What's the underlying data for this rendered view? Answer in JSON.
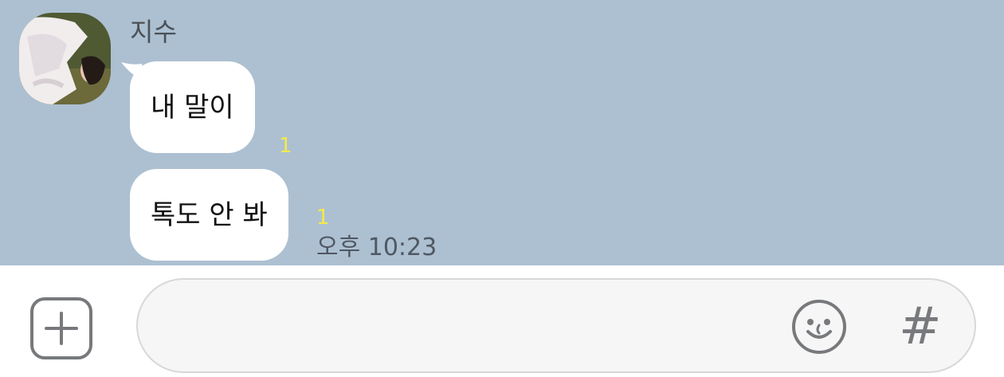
{
  "chat": {
    "sender_name": "지수",
    "messages": [
      {
        "text": "내 말이",
        "unread": "1"
      },
      {
        "text": "톡도 안 봐",
        "unread": "1"
      }
    ],
    "timestamp": "오후 10:23"
  },
  "input_bar": {
    "plus_icon": "plus-icon",
    "emoji_icon": "smiley-icon",
    "hash_label": "#"
  },
  "colors": {
    "chat_background": "#adc0d1",
    "bubble": "#ffffff",
    "unread": "#f5e94a"
  }
}
